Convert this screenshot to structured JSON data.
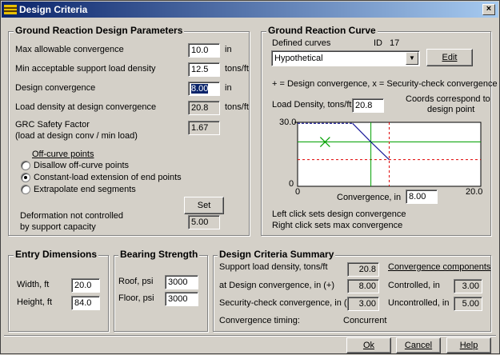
{
  "window": {
    "title": "Design Criteria",
    "close_glyph": "×"
  },
  "grp": {
    "legend": "Ground Reaction Design Parameters",
    "rows": [
      {
        "label": "Max allowable convergence",
        "value": "10.0",
        "unit": "in"
      },
      {
        "label": "Min acceptable support load density",
        "value": "12.5",
        "unit": "tons/ft"
      },
      {
        "label": "Design convergence",
        "value": "8.00",
        "unit": "in"
      },
      {
        "label": "Load density at design convergence",
        "value": "20.8",
        "unit": "tons/ft"
      }
    ],
    "safety_label_1": "GRC Safety Factor",
    "safety_label_2": "(load at design conv / min load)",
    "safety_value": "1.67",
    "offcurve_title": "Off-curve points",
    "offcurve_options": [
      "Disallow off-curve points",
      "Constant-load extension of end points",
      "Extrapolate end segments"
    ],
    "offcurve_selected": 1,
    "set_label": "Set",
    "deform_label_1": "Deformation not controlled",
    "deform_label_2": "by support capacity",
    "deform_value": "5.00"
  },
  "curve": {
    "legend": "Ground Reaction Curve",
    "defined_label": "Defined curves",
    "id_label": "ID",
    "id_value": "17",
    "selected_curve": "Hypothetical",
    "edit_label": "Edit",
    "legend_note": "+ = Design convergence, x = Security-check convergence",
    "load_density_label": "Load Density, tons/ft",
    "load_density_value": "20.8",
    "coords_note_1": "Coords correspond to",
    "coords_note_2": "design point",
    "ytick_top": "30.0",
    "ytick_bottom": "0",
    "xtick_left": "0",
    "xtick_right": "20.0",
    "xlabel": "Convergence, in",
    "conv_value": "8.00",
    "hint_1": "Left click sets design convergence",
    "hint_2": "Right click sets max convergence"
  },
  "chart_data": {
    "type": "line",
    "xlim": [
      0,
      20
    ],
    "ylim": [
      0,
      30
    ],
    "curve": {
      "x": [
        0,
        6,
        8,
        10
      ],
      "y": [
        29.5,
        29.5,
        20.8,
        12.5
      ]
    },
    "max_convergence": 10.0,
    "min_load_density": 12.5,
    "design_point": {
      "x": 8.0,
      "y": 20.8
    },
    "security_check_point": {
      "x": 3.0,
      "y": 20.8
    },
    "colors": {
      "curve": "#1a1a9a",
      "design": "#00a000",
      "limits": "#e00000"
    }
  },
  "entry": {
    "legend": "Entry Dimensions",
    "width_label": "Width, ft",
    "width_value": "20.0",
    "height_label": "Height, ft",
    "height_value": "84.0"
  },
  "bearing": {
    "legend": "Bearing Strength",
    "roof_label": "Roof, psi",
    "roof_value": "3000",
    "floor_label": "Floor, psi",
    "floor_value": "3000"
  },
  "summary": {
    "legend": "Design Criteria Summary",
    "support_label": "Support load density, tons/ft",
    "support_value": "20.8",
    "design_conv_label": "at Design convergence, in (+)",
    "design_conv_value": "8.00",
    "security_label": "Security-check convergence, in (x)",
    "security_value": "3.00",
    "timing_label": "Convergence timing:",
    "timing_value": "Concurrent",
    "components_title": "Convergence components",
    "controlled_label": "Controlled, in",
    "controlled_value": "3.00",
    "uncontrolled_label": "Uncontrolled, in",
    "uncontrolled_value": "5.00"
  },
  "buttons": {
    "ok": "Ok",
    "cancel": "Cancel",
    "help": "Help"
  }
}
